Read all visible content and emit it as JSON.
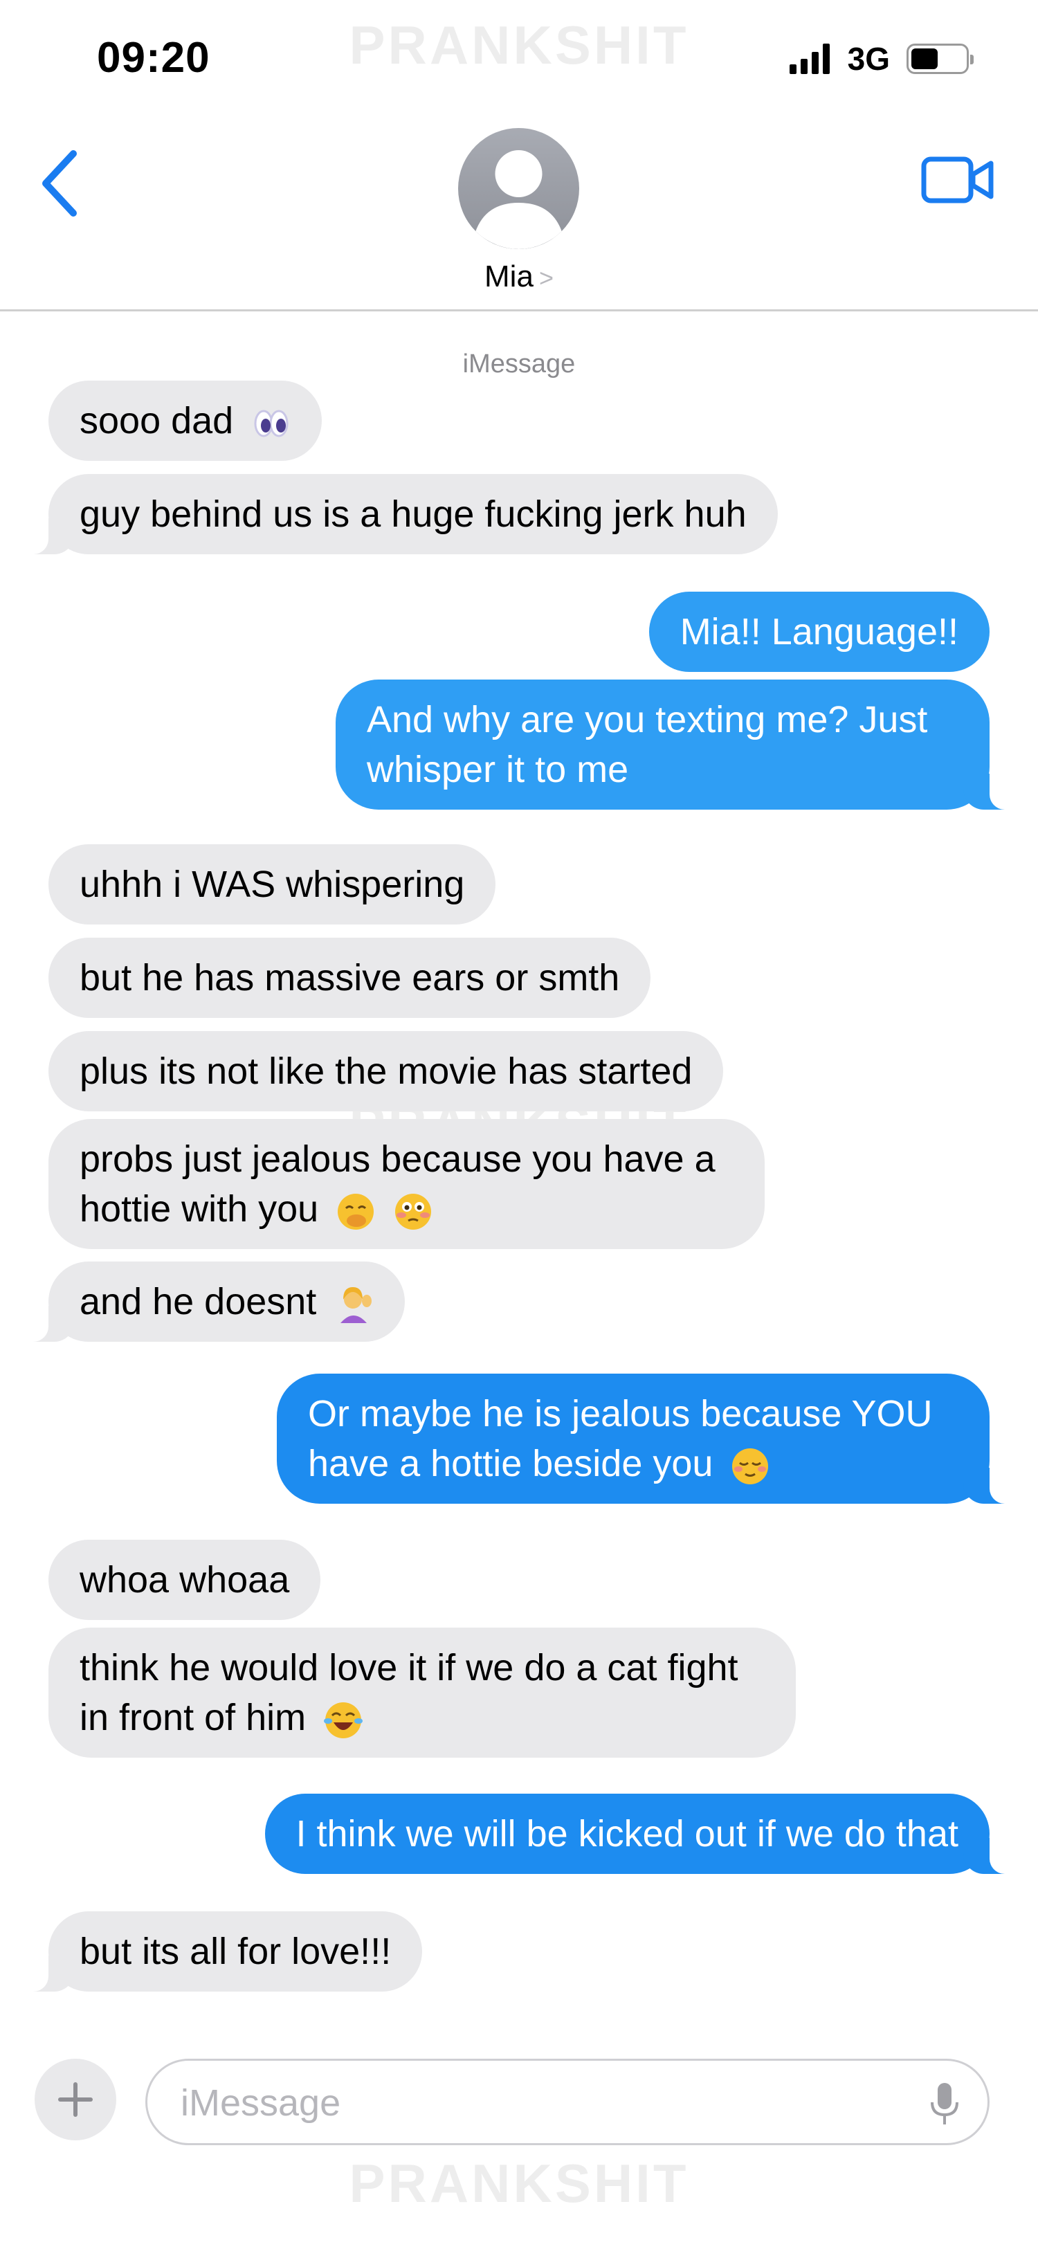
{
  "status_bar": {
    "time": "09:20",
    "network": "3G"
  },
  "watermark": "PRANKSHIT",
  "header": {
    "contact_name": "Mia",
    "name_chevron": ">"
  },
  "thread": {
    "service_label": "iMessage",
    "messages": [
      {
        "dir": "in",
        "text": "sooo dad",
        "emoji": "eyes"
      },
      {
        "dir": "in",
        "text": "guy behind us is a huge fucking jerk huh"
      },
      {
        "dir": "out",
        "text": "Mia!! Language!!"
      },
      {
        "dir": "out",
        "text": "And why are you texting me? Just whisper it to me"
      },
      {
        "dir": "in",
        "text": "uhhh i WAS whispering"
      },
      {
        "dir": "in",
        "text": "but he has massive ears or smth"
      },
      {
        "dir": "in",
        "text": "plus its not like the movie has started"
      },
      {
        "dir": "in",
        "text": "probs just jealous because you have a hottie with you",
        "emoji": "face-hand-over-mouth, flushed"
      },
      {
        "dir": "in",
        "text": "and he doesnt",
        "emoji": "person-tipping-hand"
      },
      {
        "dir": "out",
        "text": "Or maybe he is jealous because YOU have a hottie beside you",
        "emoji": "relieved"
      },
      {
        "dir": "in",
        "text": "whoa whoaa"
      },
      {
        "dir": "in",
        "text": "think he would love it if we do a cat fight in front of him",
        "emoji": "tears-of-joy"
      },
      {
        "dir": "out",
        "text": "I think we will be kicked out if we do that"
      },
      {
        "dir": "in",
        "text": "but its all for love!!!"
      }
    ]
  },
  "input_bar": {
    "placeholder": "iMessage"
  },
  "colors": {
    "accent": "#1a7cf0",
    "out_bubble": "#2f9ef4",
    "in_bubble": "#e9e9eb"
  }
}
